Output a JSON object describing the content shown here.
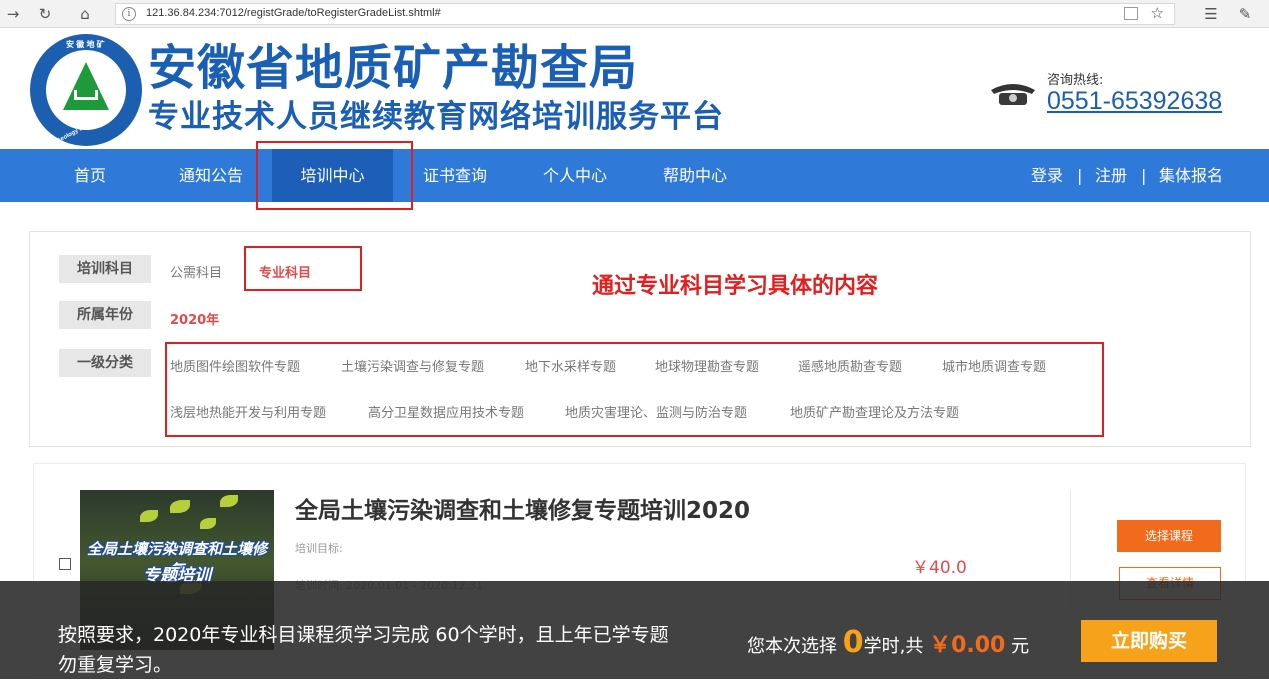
{
  "browser": {
    "url": "121.36.84.234:7012/registGrade/toRegisterGradeList.shtml#"
  },
  "header": {
    "logo_text_top": "安 徽 地 矿",
    "logo_text_bottom": "Anhui Geology and Mining",
    "title": "安徽省地质矿产勘查局",
    "subtitle": "专业技术人员继续教育网络培训服务平台",
    "hotline_label": "咨询热线:",
    "hotline_number": "0551-65392638"
  },
  "nav": {
    "items": [
      {
        "label": "首页"
      },
      {
        "label": "通知公告"
      },
      {
        "label": "培训中心",
        "active": true
      },
      {
        "label": "证书查询"
      },
      {
        "label": "个人中心"
      },
      {
        "label": "帮助中心"
      }
    ],
    "right": {
      "login": "登录",
      "sep1": "|",
      "register": "注册",
      "sep2": "|",
      "group_signup": "集体报名"
    }
  },
  "filters": {
    "subject_label": "培训科目",
    "subject_options": [
      {
        "label": "公需科目"
      },
      {
        "label": "专业科目",
        "selected": true
      }
    ],
    "year_label": "所属年份",
    "year_value": "2020年",
    "category_label": "一级分类",
    "categories": [
      "地质图件绘图软件专题",
      "土壤污染调查与修复专题",
      "地下水采样专题",
      "地球物理勘查专题",
      "遥感地质勘查专题",
      "城市地质调查专题",
      "浅层地热能开发与利用专题",
      "高分卫星数据应用技术专题",
      "地质灾害理论、监测与防治专题",
      "地质矿产勘查理论及方法专题"
    ]
  },
  "annotation": "通过专业科目学习具体的内容",
  "course": {
    "image_caption_line1": "全局土壤污染调查和土壤修复",
    "image_caption_line2": "专题培训",
    "title": "全局土壤污染调查和土壤修复专题培训2020",
    "goal": "培训目标:",
    "time": "培训时间: 2020.01.01 - 2020.12.31",
    "price": "￥40.0",
    "select_button": "选择课程",
    "detail_button": "查看详情"
  },
  "bottom_bar": {
    "note": "按照要求，2020年专业科目课程须学习完成 60个学时，且上年已学专题勿重复学习。",
    "summary_prefix": "您本次选择 ",
    "selected_hours": "0",
    "summary_middle": "学时,共 ",
    "total_amount": "￥0.00",
    "summary_suffix": " 元",
    "buy_button": "立即购买"
  },
  "colors": {
    "brand_blue": "#2f7ad8",
    "active_nav": "#1c5eb8",
    "accent_orange": "#f26b1d",
    "highlight_red": "#e02020"
  }
}
